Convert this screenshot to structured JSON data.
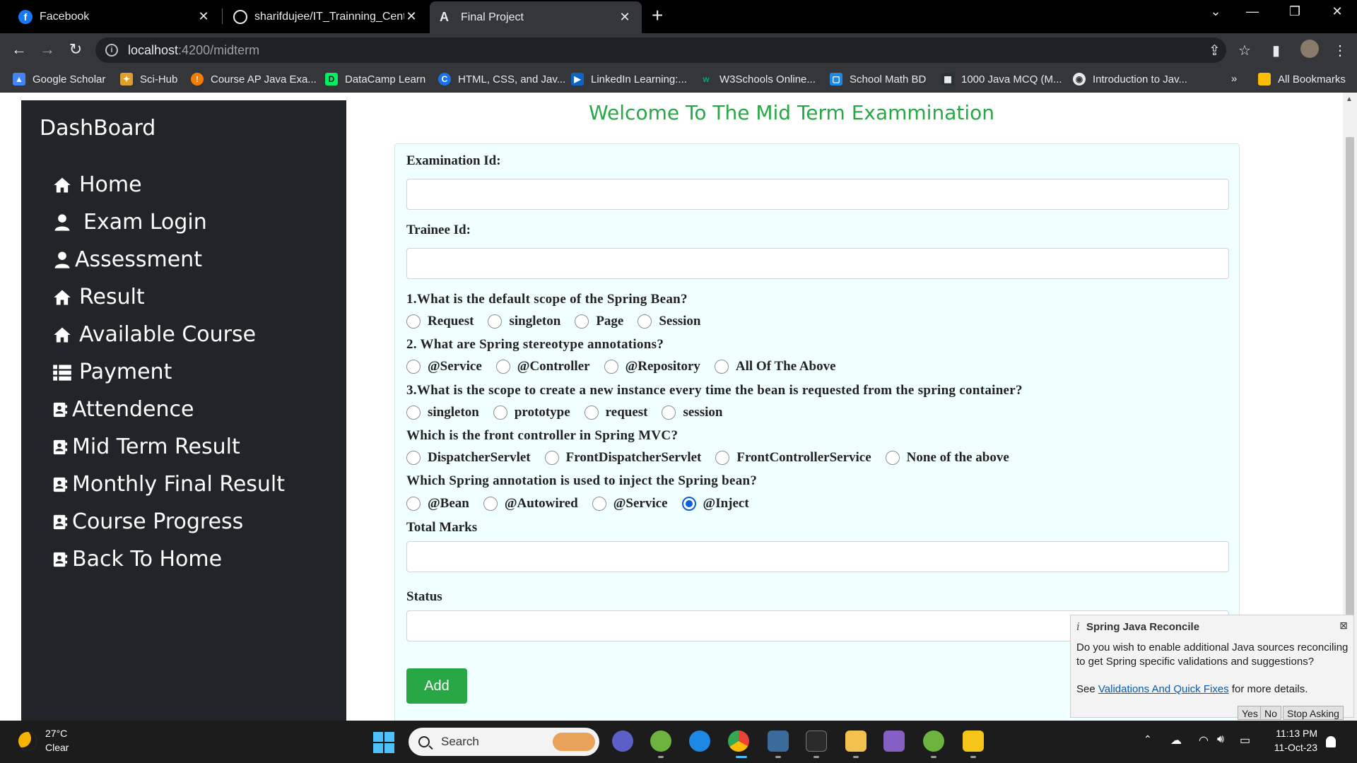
{
  "browser": {
    "tabs": [
      {
        "title": "Facebook",
        "active": false
      },
      {
        "title": "sharifdujee/IT_Trainning_Center...",
        "active": false
      },
      {
        "title": "Final Project",
        "active": true
      }
    ],
    "url_host": "localhost",
    "url_path": ":4200/midterm",
    "bookmarks": [
      "Google Scholar",
      "Sci-Hub",
      "Course AP Java Exa...",
      "DataCamp Learn",
      "HTML, CSS, and Jav...",
      "LinkedIn Learning:...",
      "W3Schools Online...",
      "School Math BD",
      "1000 Java MCQ (M...",
      "Introduction to Jav..."
    ],
    "bookmarks_overflow": "»",
    "all_bookmarks": "All Bookmarks"
  },
  "sidebar": {
    "title": "DashBoard",
    "items": [
      {
        "label": "Home",
        "icon": "home-icon"
      },
      {
        "label": "Exam Login",
        "icon": "user-icon"
      },
      {
        "label": "Assessment",
        "icon": "user-icon"
      },
      {
        "label": "Result",
        "icon": "home-icon"
      },
      {
        "label": "Available Course",
        "icon": "home-icon"
      },
      {
        "label": "Payment",
        "icon": "list-icon"
      },
      {
        "label": "Attendence",
        "icon": "address-book-icon"
      },
      {
        "label": "Mid Term Result",
        "icon": "address-book-icon"
      },
      {
        "label": "Monthly Final Result",
        "icon": "address-book-icon"
      },
      {
        "label": "Course Progress",
        "icon": "address-book-icon"
      },
      {
        "label": "Back To Home",
        "icon": "address-book-icon"
      }
    ]
  },
  "main": {
    "title": "Welcome To The Mid Term Exammination",
    "fields": {
      "exam_id_label": "Examination Id:",
      "exam_id_value": "",
      "trainee_id_label": "Trainee Id:",
      "trainee_id_value": "",
      "total_marks_label": "Total Marks",
      "total_marks_value": "",
      "status_label": "Status",
      "status_value": ""
    },
    "questions": [
      {
        "text": "1.What is the default scope of the Spring Bean?",
        "options": [
          "Request",
          "singleton",
          "Page",
          "Session"
        ],
        "selected": null
      },
      {
        "text": "2. What are Spring stereotype annotations?",
        "options": [
          "@Service",
          "@Controller",
          "@Repository",
          "All Of The Above"
        ],
        "selected": null
      },
      {
        "text": "3.What is the scope to create a new instance every time the bean is requested from the spring container?",
        "options": [
          "singleton",
          "prototype",
          "request",
          "session"
        ],
        "selected": null
      },
      {
        "text": "Which is the front controller in Spring MVC?",
        "options": [
          "DispatcherServlet",
          "FrontDispatcherServlet",
          "FrontControllerService",
          "None of the above"
        ],
        "selected": null
      },
      {
        "text": "Which Spring annotation is used to inject the Spring bean?",
        "options": [
          "@Bean",
          "@Autowired",
          "@Service",
          "@Inject"
        ],
        "selected": 3
      }
    ],
    "add_button": "Add"
  },
  "notification": {
    "title": "Spring Java Reconcile",
    "body": "Do you wish to enable additional Java sources reconciling to get Spring specific validations and suggestions?",
    "more_prefix": "See",
    "link_text": "Validations And Quick Fixes",
    "more_suffix": "for more details.",
    "buttons": [
      "Yes",
      "No",
      "Stop Asking"
    ]
  },
  "taskbar": {
    "temperature": "27°C",
    "condition": "Clear",
    "search_placeholder": "Search",
    "time": "11:13 PM",
    "date": "11-Oct-23"
  },
  "colors": {
    "sidebar_bg": "#212529",
    "title_green": "#28a745",
    "form_bg": "#f0ffff",
    "radio_selected": "#0b5ed7"
  }
}
